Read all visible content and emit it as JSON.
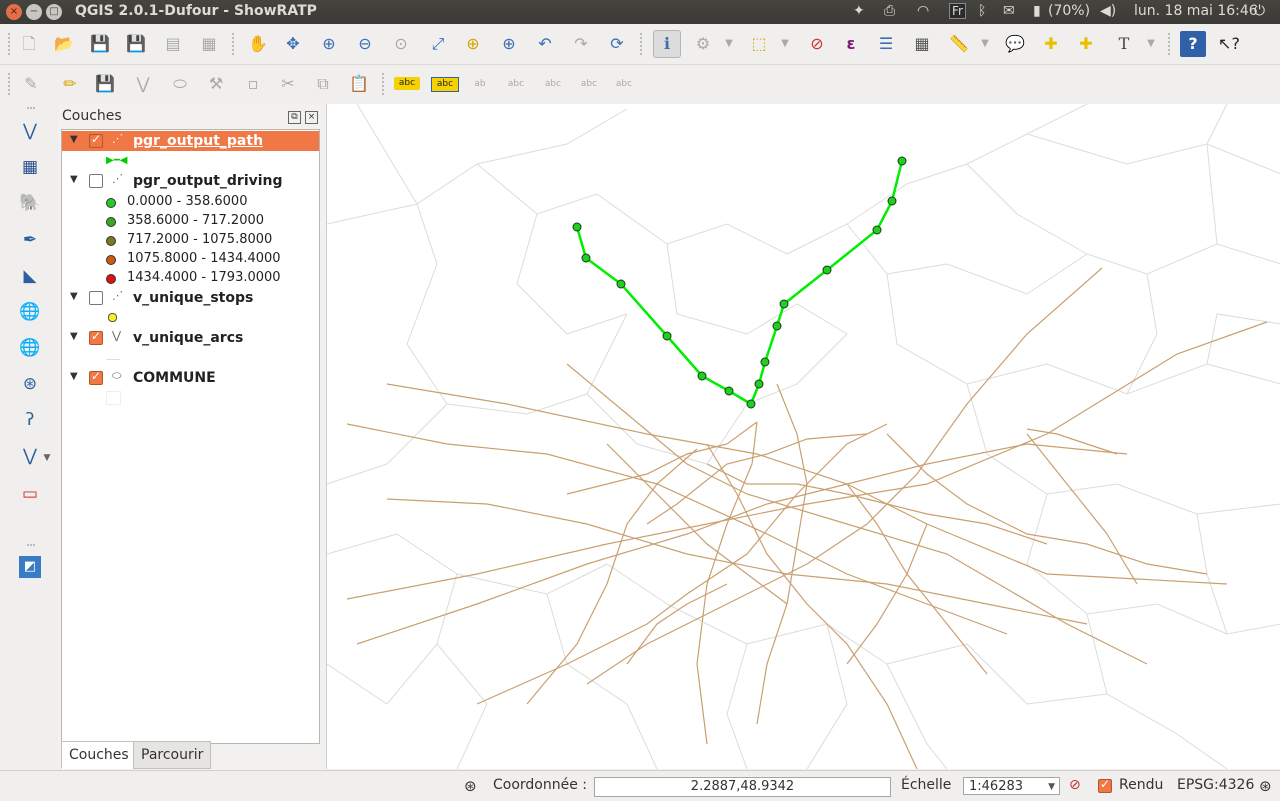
{
  "window": {
    "title": "QGIS 2.0.1-Dufour - ShowRATP",
    "close_glyph": "×",
    "minimize_glyph": "−",
    "maximize_glyph": "□"
  },
  "system_tray": {
    "keyboard_layout": "Fr",
    "battery": "(70%)",
    "datetime": "lun. 18 mai 16:46"
  },
  "layers_panel": {
    "title": "Couches",
    "layers": [
      {
        "name": "pgr_output_path",
        "checked": true,
        "selected": true
      },
      {
        "name": "pgr_output_driving",
        "checked": false,
        "selected": false,
        "classes": [
          {
            "label": "0.0000 - 358.6000",
            "color": "#22cc22"
          },
          {
            "label": "358.6000 - 717.2000",
            "color": "#3aa81e"
          },
          {
            "label": "717.2000 - 1075.8000",
            "color": "#7a7a1c"
          },
          {
            "label": "1075.8000 - 1434.4000",
            "color": "#cc5a10"
          },
          {
            "label": "1434.4000 - 1793.0000",
            "color": "#e01010"
          }
        ]
      },
      {
        "name": "v_unique_stops",
        "checked": false,
        "selected": false
      },
      {
        "name": "v_unique_arcs",
        "checked": true,
        "selected": false
      },
      {
        "name": "COMMUNE",
        "checked": true,
        "selected": false
      }
    ]
  },
  "tabs": [
    {
      "label": "Couches",
      "active": true
    },
    {
      "label": "Parcourir",
      "active": false
    }
  ],
  "statusbar": {
    "coord_label": "Coordonnée :",
    "coord_value": "2.2887,48.9342",
    "scale_label": "Échelle",
    "scale_value": "1:46283",
    "render_label": "Rendu",
    "crs": "EPSG:4326"
  },
  "toolbar": {
    "text_tool_glyph": "T",
    "help_glyph": "?",
    "label_tool_glyphs": [
      "abc",
      "abc",
      "ab",
      "abc",
      "abc",
      "abc",
      "abc"
    ]
  },
  "map": {
    "path_color": "#00ee00",
    "route_color": "#c9a070",
    "commune_border_color": "#dcdcdc"
  }
}
